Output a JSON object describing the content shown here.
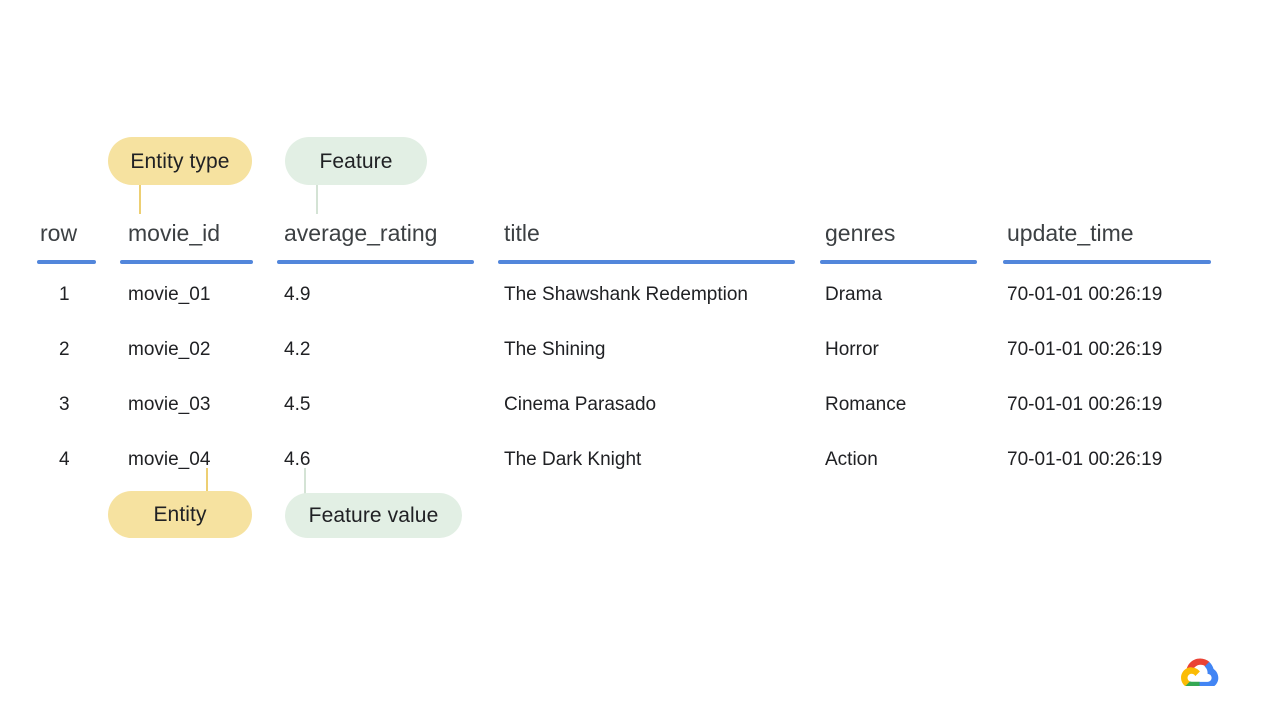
{
  "slide": {
    "background_color": "#ffffff",
    "accent_rule_color": "#5286DB",
    "entity_pill_color": "#F6E2A0",
    "feature_pill_color": "#E2EFE4"
  },
  "annotations": {
    "entity_type": {
      "label": "Entity type",
      "points_to_column": "movie_id"
    },
    "feature": {
      "label": "Feature",
      "points_to_column": "average_rating"
    },
    "entity": {
      "label": "Entity",
      "points_to_value": "movie_04"
    },
    "feature_value": {
      "label": "Feature value",
      "points_to_value": "4.6"
    }
  },
  "table": {
    "columns": [
      {
        "key": "row",
        "label": "row"
      },
      {
        "key": "movie_id",
        "label": "movie_id"
      },
      {
        "key": "average_rating",
        "label": "average_rating"
      },
      {
        "key": "title",
        "label": "title"
      },
      {
        "key": "genres",
        "label": "genres"
      },
      {
        "key": "update_time",
        "label": "update_time"
      }
    ],
    "rows": [
      {
        "row": "1",
        "movie_id": "movie_01",
        "average_rating": "4.9",
        "title": "The Shawshank Redemption",
        "genres": "Drama",
        "update_time": "70-01-01 00:26:19"
      },
      {
        "row": "2",
        "movie_id": "movie_02",
        "average_rating": "4.2",
        "title": "The Shining",
        "genres": "Horror",
        "update_time": "70-01-01 00:26:19"
      },
      {
        "row": "3",
        "movie_id": "movie_03",
        "average_rating": "4.5",
        "title": "Cinema Parasado",
        "genres": "Romance",
        "update_time": "70-01-01 00:26:19"
      },
      {
        "row": "4",
        "movie_id": "movie_04",
        "average_rating": "4.6",
        "title": "The Dark Knight",
        "genres": "Action",
        "update_time": "70-01-01 00:26:19"
      }
    ]
  },
  "footer": {
    "logo": "google-cloud-logo"
  }
}
